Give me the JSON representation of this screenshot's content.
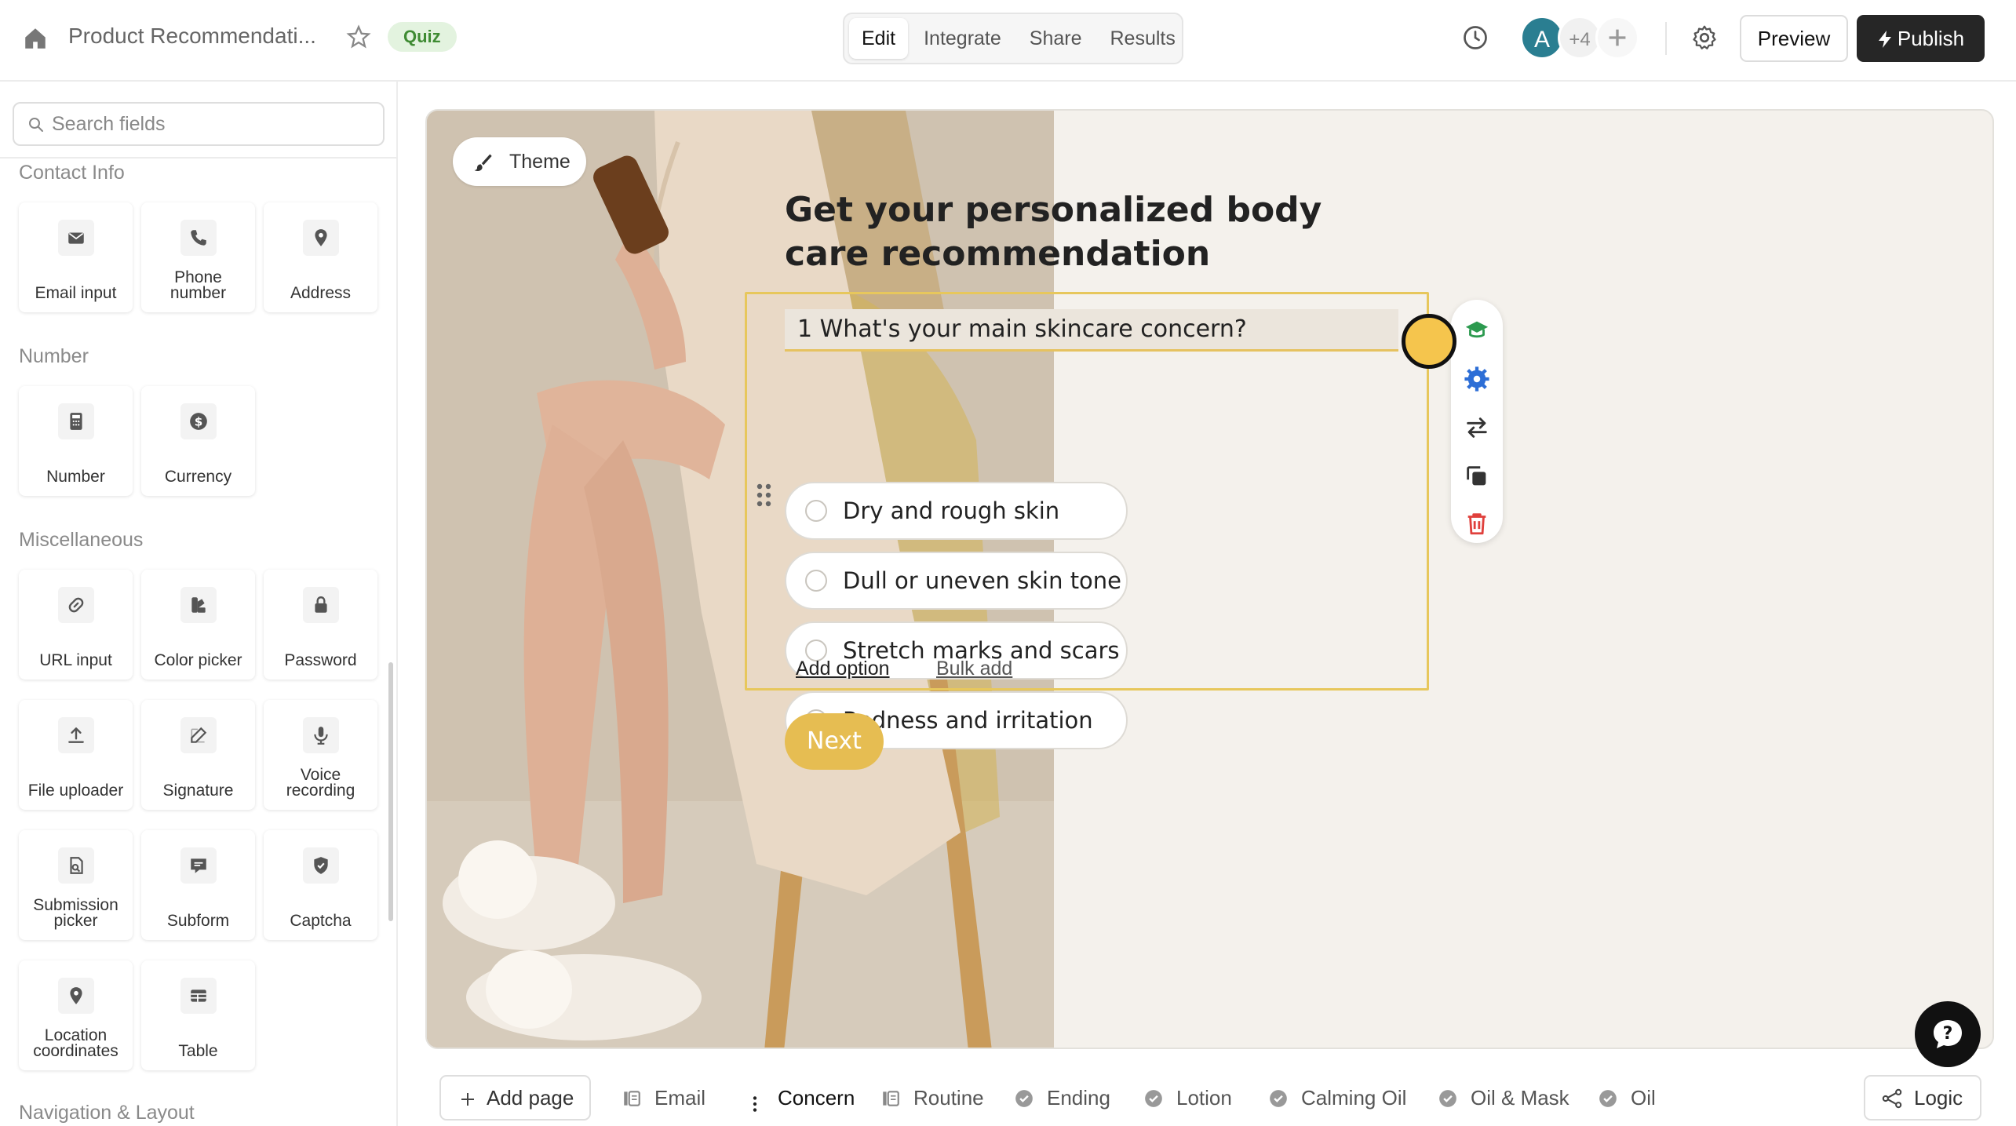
{
  "header": {
    "title": "Product Recommendati...",
    "badge": "Quiz",
    "tabs": [
      "Edit",
      "Integrate",
      "Share",
      "Results"
    ],
    "active_tab": "Edit",
    "avatar_initial": "A",
    "avatar_more": "+4",
    "preview_label": "Preview",
    "publish_label": "Publish"
  },
  "sidebar": {
    "search_placeholder": "Search fields",
    "sections": {
      "contact": "Contact Info",
      "number": "Number",
      "misc": "Miscellaneous",
      "nav": "Navigation & Layout"
    },
    "fields": {
      "email": "Email input",
      "phone": "Phone number",
      "address": "Address",
      "number": "Number",
      "currency": "Currency",
      "url": "URL input",
      "color": "Color picker",
      "password": "Password",
      "file": "File uploader",
      "signature": "Signature",
      "voice": "Voice recording",
      "submission": "Submission picker",
      "subform": "Subform",
      "captcha": "Captcha",
      "location": "Location coordinates",
      "table": "Table"
    }
  },
  "canvas": {
    "theme_label": "Theme",
    "form_title": "Get your personalized body care recommendation",
    "question": "1 What's your main skincare concern?",
    "options": [
      "Dry and rough skin",
      "Dull or uneven skin tone",
      "Stretch marks and scars",
      "Redness and irritation"
    ],
    "add_option": "Add option",
    "bulk_add": "Bulk add",
    "next_label": "Next"
  },
  "pages": {
    "add_page": "Add page",
    "items": [
      "Email",
      "Concern",
      "Routine",
      "Ending",
      "Lotion",
      "Calming Oil",
      "Oil & Mask",
      "Oil"
    ],
    "active": "Concern",
    "logic_label": "Logic"
  },
  "colors": {
    "accent": "#e6bd52",
    "publish_bg": "#262626",
    "badge_bg": "#e3f3df",
    "badge_text": "#3f8b33",
    "avatar_bg": "#2a7e91"
  }
}
